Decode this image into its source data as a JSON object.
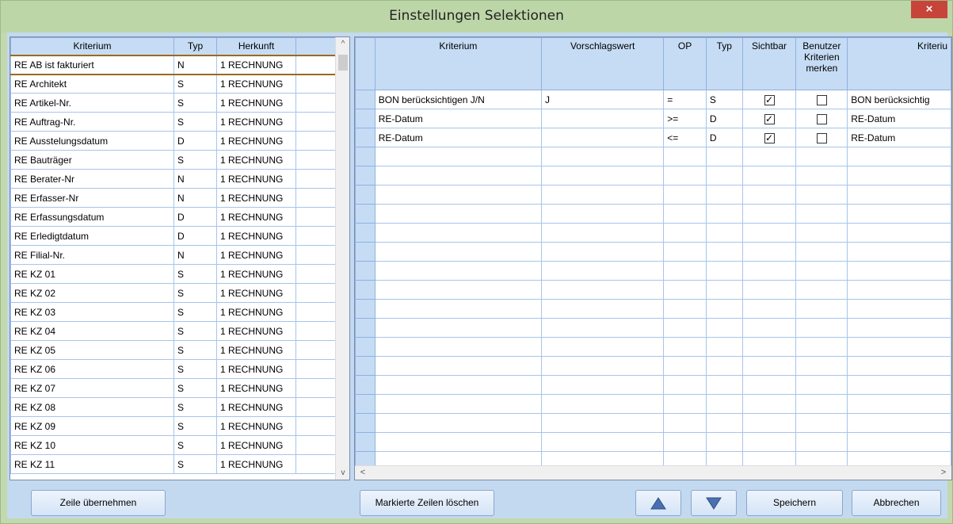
{
  "window": {
    "title": "Einstellungen Selektionen",
    "close_glyph": "×"
  },
  "left_grid": {
    "headers": [
      "Kriterium",
      "Typ",
      "Herkunft"
    ],
    "rows": [
      [
        "RE  AB ist fakturiert",
        "N",
        "1 RECHNUNG"
      ],
      [
        "RE Architekt",
        "S",
        "1 RECHNUNG"
      ],
      [
        "RE Artikel-Nr.",
        "S",
        "1 RECHNUNG"
      ],
      [
        "RE Auftrag-Nr.",
        "S",
        "1 RECHNUNG"
      ],
      [
        "RE Ausstelungsdatum",
        "D",
        "1 RECHNUNG"
      ],
      [
        "RE Bauträger",
        "S",
        "1 RECHNUNG"
      ],
      [
        "RE Berater-Nr",
        "N",
        "1 RECHNUNG"
      ],
      [
        "RE Erfasser-Nr",
        "N",
        "1 RECHNUNG"
      ],
      [
        "RE Erfassungsdatum",
        "D",
        "1 RECHNUNG"
      ],
      [
        "RE Erledigtdatum",
        "D",
        "1 RECHNUNG"
      ],
      [
        "RE Filial-Nr.",
        "N",
        "1 RECHNUNG"
      ],
      [
        "RE KZ 01",
        "S",
        "1 RECHNUNG"
      ],
      [
        "RE KZ 02",
        "S",
        "1 RECHNUNG"
      ],
      [
        "RE KZ 03",
        "S",
        "1 RECHNUNG"
      ],
      [
        "RE KZ 04",
        "S",
        "1 RECHNUNG"
      ],
      [
        "RE KZ 05",
        "S",
        "1 RECHNUNG"
      ],
      [
        "RE KZ 06",
        "S",
        "1 RECHNUNG"
      ],
      [
        "RE KZ 07",
        "S",
        "1 RECHNUNG"
      ],
      [
        "RE KZ 08",
        "S",
        "1 RECHNUNG"
      ],
      [
        "RE KZ 09",
        "S",
        "1 RECHNUNG"
      ],
      [
        "RE KZ 10",
        "S",
        "1 RECHNUNG"
      ],
      [
        "RE KZ 11",
        "S",
        "1 RECHNUNG"
      ]
    ],
    "scroll_up": "^",
    "scroll_down": "v"
  },
  "right_grid": {
    "headers": [
      "Kriterium",
      "Vorschlagswert",
      "OP",
      "Typ",
      "Sichtbar",
      "Benutzer Kriterien merken",
      "Kriteriu"
    ],
    "rows": [
      {
        "kriterium": "BON berücksichtigen J/N",
        "wert": "J",
        "op": "=",
        "typ": "S",
        "sichtbar": true,
        "merken": false,
        "kriterium2": "BON berücksichtig"
      },
      {
        "kriterium": "RE-Datum",
        "wert": "",
        "op": ">=",
        "typ": "D",
        "sichtbar": true,
        "merken": false,
        "kriterium2": "RE-Datum"
      },
      {
        "kriterium": "RE-Datum",
        "wert": "",
        "op": "<=",
        "typ": "D",
        "sichtbar": true,
        "merken": false,
        "kriterium2": "RE-Datum"
      }
    ],
    "empty_rows": 17,
    "scroll_left": "<",
    "scroll_right": ">"
  },
  "buttons": {
    "zeile_uebernehmen": "Zeile übernehmen",
    "markierte_loeschen": "Markierte Zeilen löschen",
    "up_icon": "up-triangle-icon",
    "down_icon": "down-triangle-icon",
    "speichern": "Speichern",
    "abbrechen": "Abbrechen"
  }
}
